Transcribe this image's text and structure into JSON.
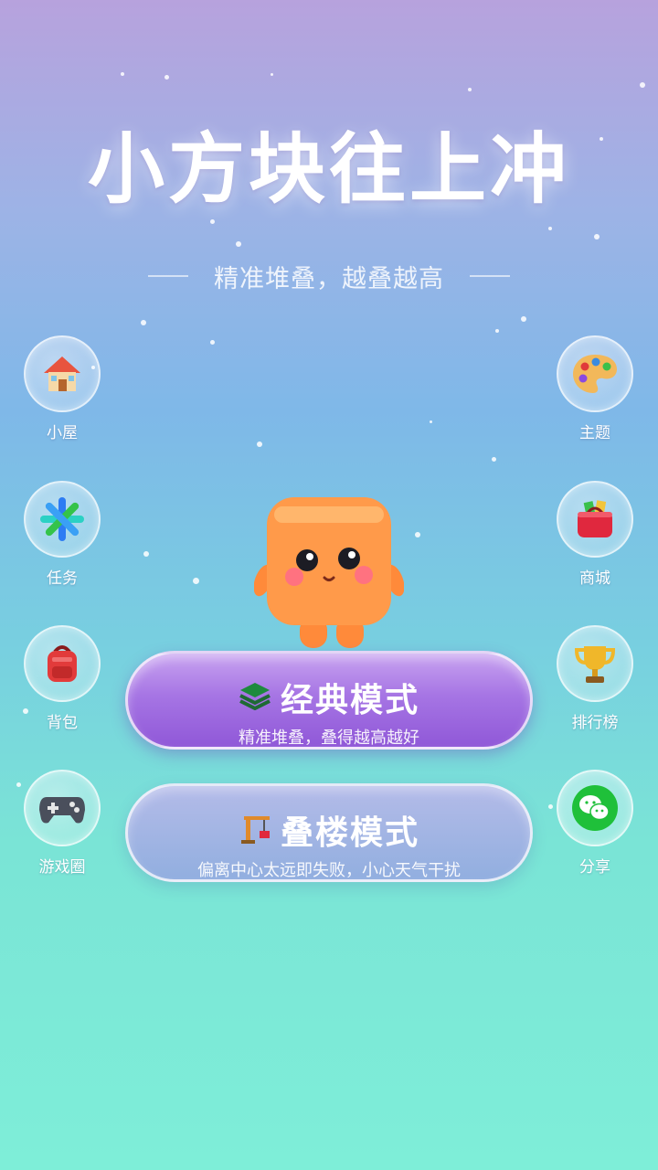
{
  "title": "小方块往上冲",
  "subtitle": "精准堆叠，越叠越高",
  "left_menu": [
    {
      "label": "小屋",
      "icon": "house-icon"
    },
    {
      "label": "任务",
      "icon": "task-star-icon"
    },
    {
      "label": "背包",
      "icon": "backpack-icon"
    },
    {
      "label": "游戏圈",
      "icon": "gamepad-icon"
    }
  ],
  "right_menu": [
    {
      "label": "主题",
      "icon": "palette-icon"
    },
    {
      "label": "商城",
      "icon": "shopping-bag-icon"
    },
    {
      "label": "排行榜",
      "icon": "trophy-icon"
    },
    {
      "label": "分享",
      "icon": "wechat-icon"
    }
  ],
  "modes": {
    "classic": {
      "name": "经典模式",
      "desc": "精准堆叠，叠得越高越好",
      "icon": "layers-icon"
    },
    "tower": {
      "name": "叠楼模式",
      "desc": "偏离中心太远即失败，小心天气干扰",
      "icon": "crane-icon"
    }
  },
  "colors": {
    "accent_purple": "#9b63dc",
    "mascot_orange": "#ff9a4a"
  }
}
